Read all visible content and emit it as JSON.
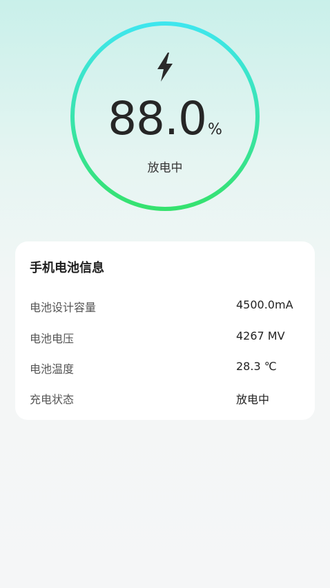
{
  "battery": {
    "percent": "88.0",
    "unit": "%",
    "status": "放电中",
    "level_fraction": 0.88,
    "icon": "lightning-bolt-icon"
  },
  "colors": {
    "ring_top": "#3ee6ee",
    "ring_bottom": "#35e26e",
    "card_background": "#ffffff"
  },
  "info_card": {
    "title": "手机电池信息",
    "rows": [
      {
        "label": "电池设计容量",
        "value": "4500.0mA"
      },
      {
        "label": "电池电压",
        "value": "4267 MV"
      },
      {
        "label": "电池温度",
        "value": "28.3 ℃"
      },
      {
        "label": "充电状态",
        "value": "放电中"
      }
    ]
  }
}
